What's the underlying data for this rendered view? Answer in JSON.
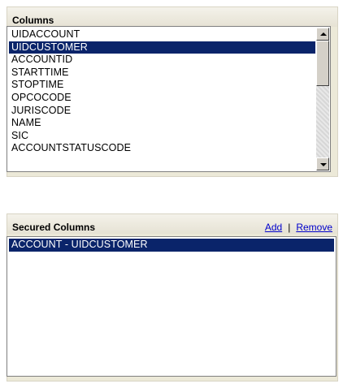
{
  "columns_panel": {
    "title": "Columns",
    "items": [
      "UIDACCOUNT",
      "UIDCUSTOMER",
      "ACCOUNTID",
      "STARTTIME",
      "STOPTIME",
      "OPCOCODE",
      "JURISCODE",
      "NAME",
      "SIC",
      "ACCOUNTSTATUSCODE"
    ],
    "selected_item": "UIDCUSTOMER"
  },
  "secured_panel": {
    "title": "Secured Columns",
    "add_label": "Add",
    "separator": "|",
    "remove_label": "Remove",
    "items": [
      "ACCOUNT - UIDCUSTOMER"
    ],
    "selected_item": "ACCOUNT - UIDCUSTOMER"
  },
  "colors": {
    "selection": "#0a246a",
    "panel_bg": "#ece9d8",
    "link": "#0000cc"
  }
}
